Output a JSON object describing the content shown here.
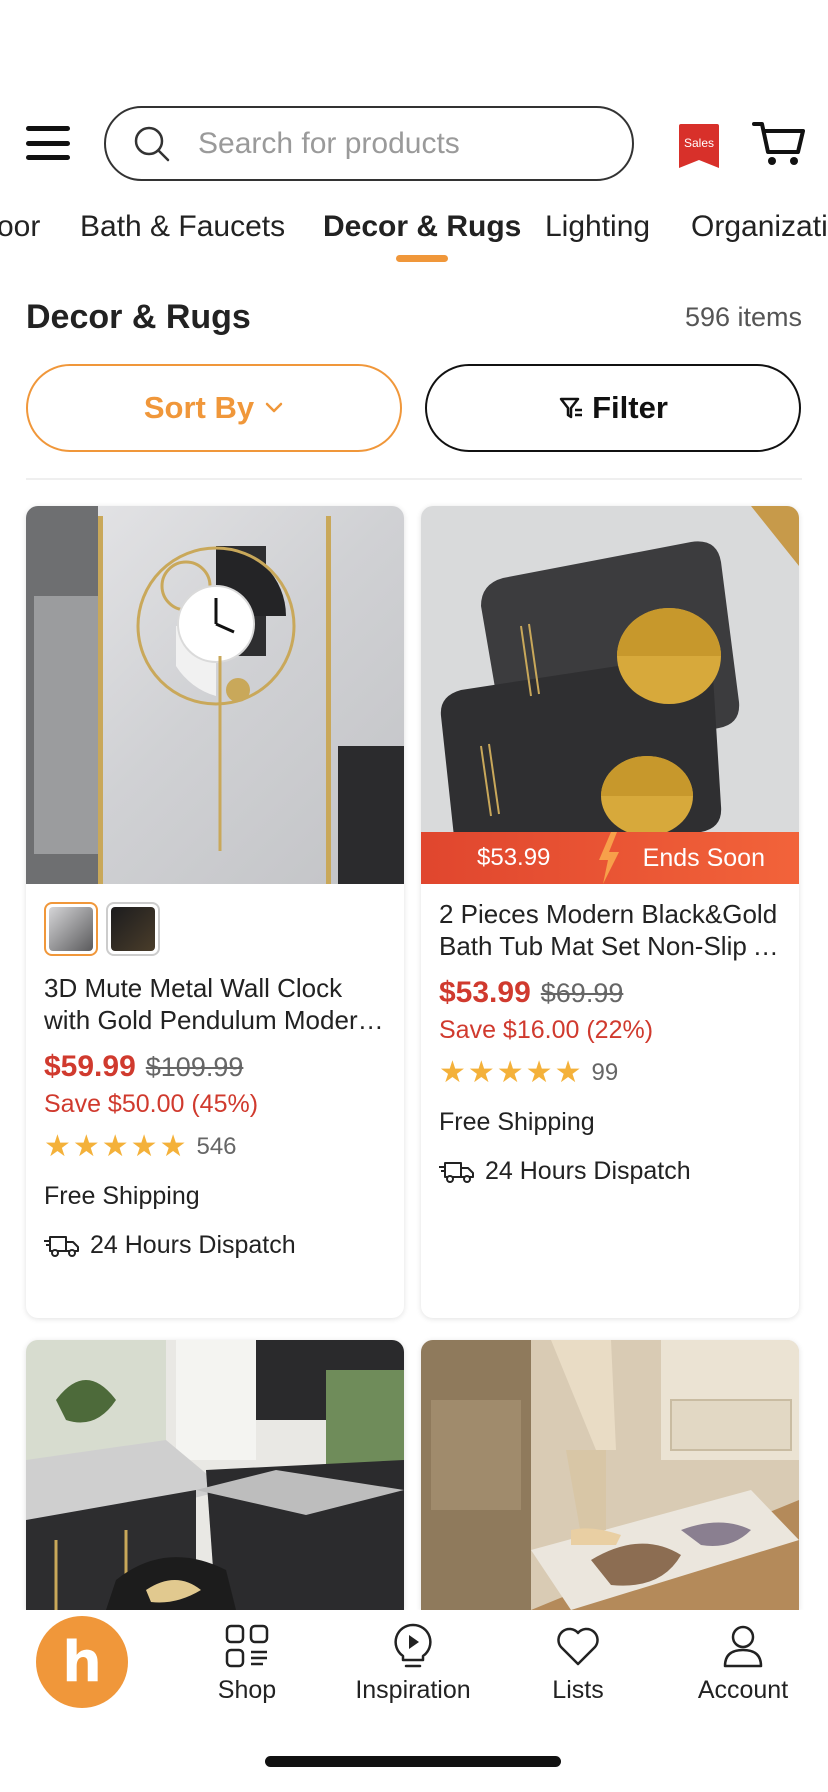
{
  "header": {
    "search_placeholder": "Search for products",
    "sales_badge": "Sales"
  },
  "tabs": [
    {
      "label": "oor"
    },
    {
      "label": "Bath & Faucets"
    },
    {
      "label": "Decor & Rugs",
      "active": true
    },
    {
      "label": "Lighting"
    },
    {
      "label": "Organization"
    }
  ],
  "section": {
    "title": "Decor & Rugs",
    "count": "596 items",
    "sort_label": "Sort By",
    "filter_label": "Filter"
  },
  "products": [
    {
      "title_line1": "3D Mute Metal Wall Clock",
      "title_line2": "with Gold Pendulum Modern Wall Clock",
      "price": "$59.99",
      "old_price": "$109.99",
      "save": "Save $50.00 (45%)",
      "stars": "★★★★★",
      "rating_count": "546",
      "shipping": "Free Shipping",
      "dispatch": "24 Hours Dispatch"
    },
    {
      "title_line1": "2 Pieces Modern Black&Gold",
      "title_line2": "Bath Tub Mat Set Non-Slip Absorbent",
      "price": "$53.99",
      "old_price": "$69.99",
      "save": "Save $16.00 (22%)",
      "stars": "★★★★★",
      "rating_count": "99",
      "shipping": "Free Shipping",
      "dispatch": "24 Hours Dispatch",
      "deal_price": "$53.99",
      "deal_label": "Ends Soon"
    }
  ],
  "bottom_nav": {
    "logo": "h",
    "items": [
      {
        "label": "Shop"
      },
      {
        "label": "Inspiration"
      },
      {
        "label": "Lists"
      },
      {
        "label": "Account"
      }
    ]
  },
  "colors": {
    "accent": "#f0973a",
    "price_red": "#d03a2e",
    "star": "#f4b13a"
  }
}
